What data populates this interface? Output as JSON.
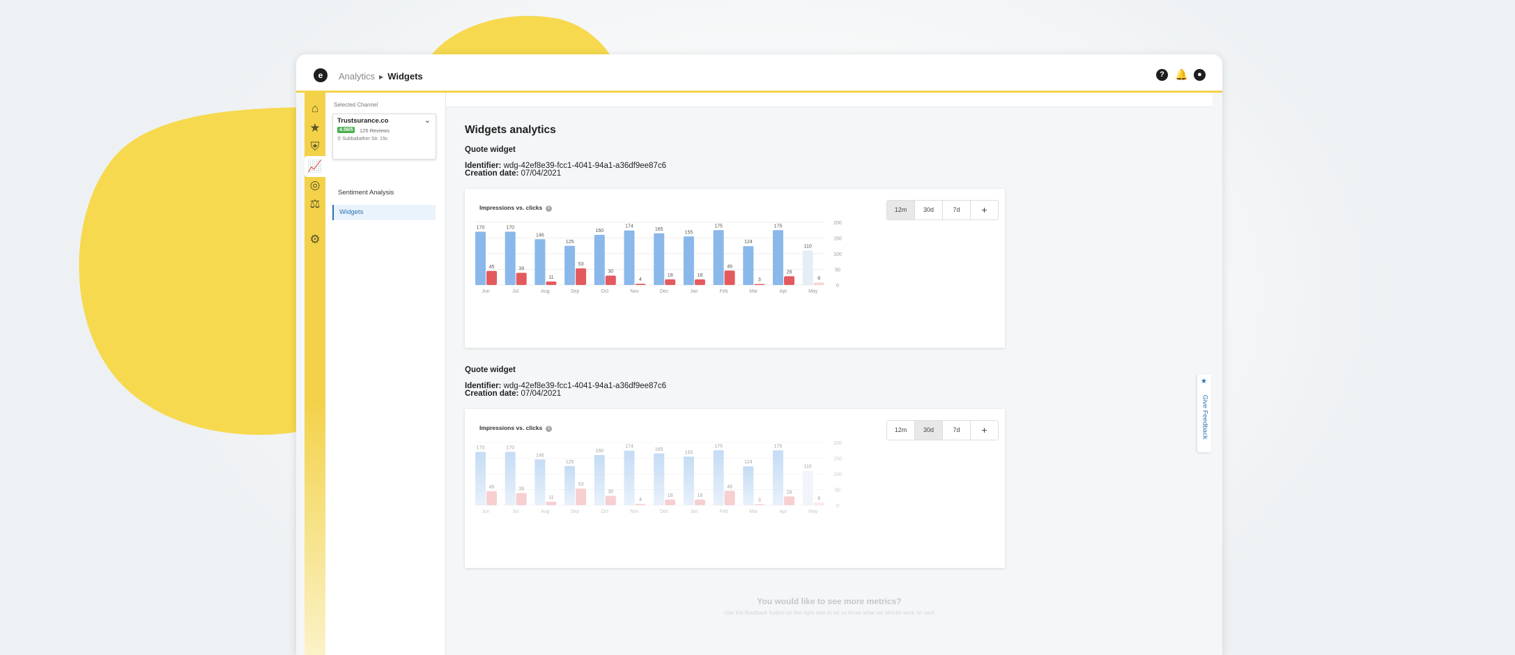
{
  "colors": {
    "accent": "#f3d24a",
    "impressions": "#8ab8ea",
    "clicks": "#e35a5e",
    "link_active": "#2a6fb0",
    "rating": "#4caf50"
  },
  "header": {
    "breadcrumb": [
      "Analytics",
      "Widgets"
    ],
    "icons": [
      "help-icon",
      "bell-icon",
      "account-icon"
    ]
  },
  "rail": {
    "icons": [
      "home-icon",
      "star-icon",
      "shield-check-icon",
      "chart-icon",
      "compass-icon",
      "scales-icon",
      "gear-icon"
    ],
    "active": "chart-icon"
  },
  "sidebar": {
    "selected_channel_label": "Selected Channel",
    "channel": {
      "name": "Trustsurance.co",
      "rating": "4.56/5",
      "reviews": "125 Reviews",
      "address": "Subbaltather Str. 15c"
    },
    "links": [
      "Sentiment Analysis",
      "Widgets"
    ],
    "active_link": "Widgets"
  },
  "page": {
    "title": "Widgets analytics",
    "identifier_label": "Identifier:",
    "creation_label": "Creation date:",
    "widgets": [
      {
        "title": "Quote widget",
        "identifier": "wdg-42ef8e39-fcc1-4041-94a1-a36df9ee87c6",
        "creation_date": "07/04/2021",
        "selected_range": "12m"
      },
      {
        "title": "Quote widget",
        "identifier": "wdg-42ef8e39-fcc1-4041-94a1-a36df9ee87c6",
        "creation_date": "07/04/2021",
        "selected_range": "30d"
      }
    ],
    "card_title": "Impressions vs. clicks",
    "ranges": [
      "12m",
      "30d",
      "7d",
      "+"
    ],
    "more_metrics_title": "You would like to see more metrics?",
    "more_metrics_sub": "Use the feedback button on the right side to let us know what we should work on next"
  },
  "feedback": {
    "label": "Give Feedback"
  },
  "chart_data": [
    {
      "type": "bar",
      "title": "Impressions vs. clicks",
      "categories": [
        "Jun",
        "Jul",
        "Aug",
        "Sep",
        "Oct",
        "Nov",
        "Dec",
        "Jan",
        "Feb",
        "Mar",
        "Apr",
        "May"
      ],
      "series": [
        {
          "values": [
            170,
            170,
            146,
            125,
            160,
            174,
            165,
            155,
            175,
            124,
            175,
            110
          ]
        },
        {
          "values": [
            45,
            39,
            11,
            53,
            30,
            4,
            18,
            18,
            46,
            3,
            28,
            8
          ]
        }
      ],
      "ylim": [
        0,
        200
      ],
      "yticks": [
        0,
        50,
        100,
        150,
        200
      ],
      "y_axis_side": "right",
      "grid": true
    },
    {
      "type": "bar",
      "title": "Impressions vs. clicks",
      "categories": [
        "Jun",
        "Jul",
        "Aug",
        "Sep",
        "Oct",
        "Nov",
        "Dec",
        "Jan",
        "Feb",
        "Mar",
        "Apr",
        "May"
      ],
      "series": [
        {
          "values": [
            170,
            170,
            146,
            125,
            160,
            174,
            165,
            155,
            175,
            124,
            175,
            110
          ]
        },
        {
          "values": [
            45,
            39,
            11,
            53,
            30,
            4,
            18,
            18,
            46,
            3,
            28,
            8
          ]
        }
      ],
      "ylim": [
        0,
        200
      ],
      "yticks": [
        0,
        50,
        100,
        150,
        200
      ],
      "y_axis_side": "right",
      "grid": true
    }
  ]
}
